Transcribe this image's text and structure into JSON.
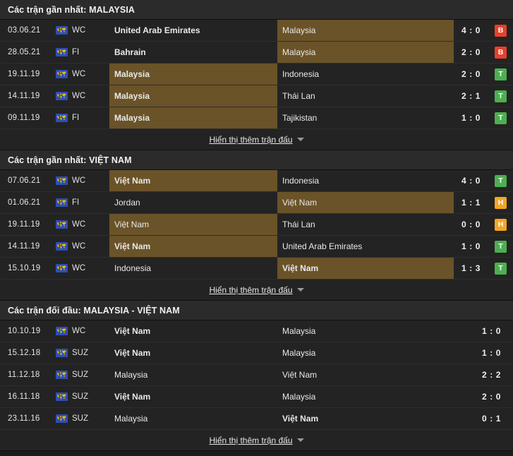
{
  "colors": {
    "highlight": "#6a5328",
    "row_bg": "#232323",
    "header_bg": "#2b2b2b",
    "page_bg": "#1c1c1c",
    "win": "#4caf50",
    "draw": "#f5a623",
    "loss": "#e8402a"
  },
  "show_more_label": "Hiển thị thêm trận đấu",
  "sections": [
    {
      "title": "Các trận gần nhất: MALAYSIA",
      "variant": "form",
      "rows": [
        {
          "date": "03.06.21",
          "comp": "WC",
          "home": "United Arab Emirates",
          "away": "Malaysia",
          "score": "4 : 0",
          "badge": "B",
          "badge_type": "loss",
          "highlight": "away",
          "bold": "home"
        },
        {
          "date": "28.05.21",
          "comp": "FI",
          "home": "Bahrain",
          "away": "Malaysia",
          "score": "2 : 0",
          "badge": "B",
          "badge_type": "loss",
          "highlight": "away",
          "bold": "home"
        },
        {
          "date": "19.11.19",
          "comp": "WC",
          "home": "Malaysia",
          "away": "Indonesia",
          "score": "2 : 0",
          "badge": "T",
          "badge_type": "win",
          "highlight": "home",
          "bold": "home"
        },
        {
          "date": "14.11.19",
          "comp": "WC",
          "home": "Malaysia",
          "away": "Thái Lan",
          "score": "2 : 1",
          "badge": "T",
          "badge_type": "win",
          "highlight": "home",
          "bold": "home"
        },
        {
          "date": "09.11.19",
          "comp": "FI",
          "home": "Malaysia",
          "away": "Tajikistan",
          "score": "1 : 0",
          "badge": "T",
          "badge_type": "win",
          "highlight": "home",
          "bold": "home"
        }
      ]
    },
    {
      "title": "Các trận gần nhất: VIỆT NAM",
      "variant": "form",
      "rows": [
        {
          "date": "07.06.21",
          "comp": "WC",
          "home": "Việt Nam",
          "away": "Indonesia",
          "score": "4 : 0",
          "badge": "T",
          "badge_type": "win",
          "highlight": "home",
          "bold": "home"
        },
        {
          "date": "01.06.21",
          "comp": "FI",
          "home": "Jordan",
          "away": "Việt Nam",
          "score": "1 : 1",
          "badge": "H",
          "badge_type": "draw",
          "highlight": "away",
          "bold": "none"
        },
        {
          "date": "19.11.19",
          "comp": "WC",
          "home": "Việt Nam",
          "away": "Thái Lan",
          "score": "0 : 0",
          "badge": "H",
          "badge_type": "draw",
          "highlight": "home",
          "bold": "none"
        },
        {
          "date": "14.11.19",
          "comp": "WC",
          "home": "Việt Nam",
          "away": "United Arab Emirates",
          "score": "1 : 0",
          "badge": "T",
          "badge_type": "win",
          "highlight": "home",
          "bold": "home"
        },
        {
          "date": "15.10.19",
          "comp": "WC",
          "home": "Indonesia",
          "away": "Việt Nam",
          "score": "1 : 3",
          "badge": "T",
          "badge_type": "win",
          "highlight": "away",
          "bold": "away"
        }
      ]
    },
    {
      "title": "Các trận đối đầu: MALAYSIA - VIỆT NAM",
      "variant": "h2h",
      "rows": [
        {
          "date": "10.10.19",
          "comp": "WC",
          "home": "Việt Nam",
          "away": "Malaysia",
          "score": "1 : 0",
          "badge": "",
          "badge_type": "",
          "highlight": "none",
          "bold": "home"
        },
        {
          "date": "15.12.18",
          "comp": "SUZ",
          "home": "Việt Nam",
          "away": "Malaysia",
          "score": "1 : 0",
          "badge": "",
          "badge_type": "",
          "highlight": "none",
          "bold": "home"
        },
        {
          "date": "11.12.18",
          "comp": "SUZ",
          "home": "Malaysia",
          "away": "Việt Nam",
          "score": "2 : 2",
          "badge": "",
          "badge_type": "",
          "highlight": "none",
          "bold": "none"
        },
        {
          "date": "16.11.18",
          "comp": "SUZ",
          "home": "Việt Nam",
          "away": "Malaysia",
          "score": "2 : 0",
          "badge": "",
          "badge_type": "",
          "highlight": "none",
          "bold": "home"
        },
        {
          "date": "23.11.16",
          "comp": "SUZ",
          "home": "Malaysia",
          "away": "Việt Nam",
          "score": "0 : 1",
          "badge": "",
          "badge_type": "",
          "highlight": "none",
          "bold": "away"
        }
      ]
    }
  ]
}
